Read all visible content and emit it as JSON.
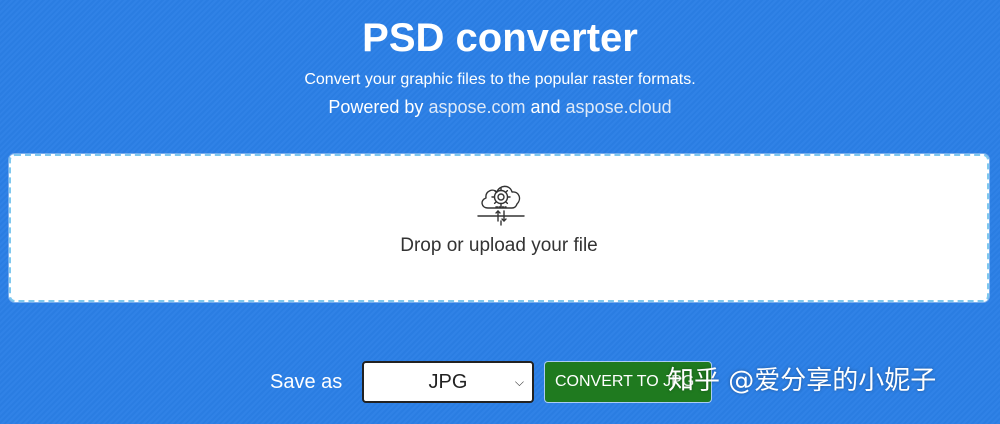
{
  "header": {
    "title": "PSD converter",
    "subtitle": "Convert your graphic files to the popular raster formats.",
    "powered_prefix": "Powered by ",
    "powered_link1": "aspose.com",
    "powered_and": " and ",
    "powered_link2": "aspose.cloud"
  },
  "dropzone": {
    "icon": "cloud-gear-upload-icon",
    "text": "Drop or upload your file"
  },
  "form": {
    "save_as_label": "Save as",
    "format_selected": "JPG",
    "convert_label": "CONVERT TO JPG"
  },
  "watermark": {
    "text": "知乎 @爱分享的小妮子"
  },
  "colors": {
    "background": "#2b7fe6",
    "convert_button": "#1f7a1f",
    "dropzone_border": "#7ec8ef"
  }
}
